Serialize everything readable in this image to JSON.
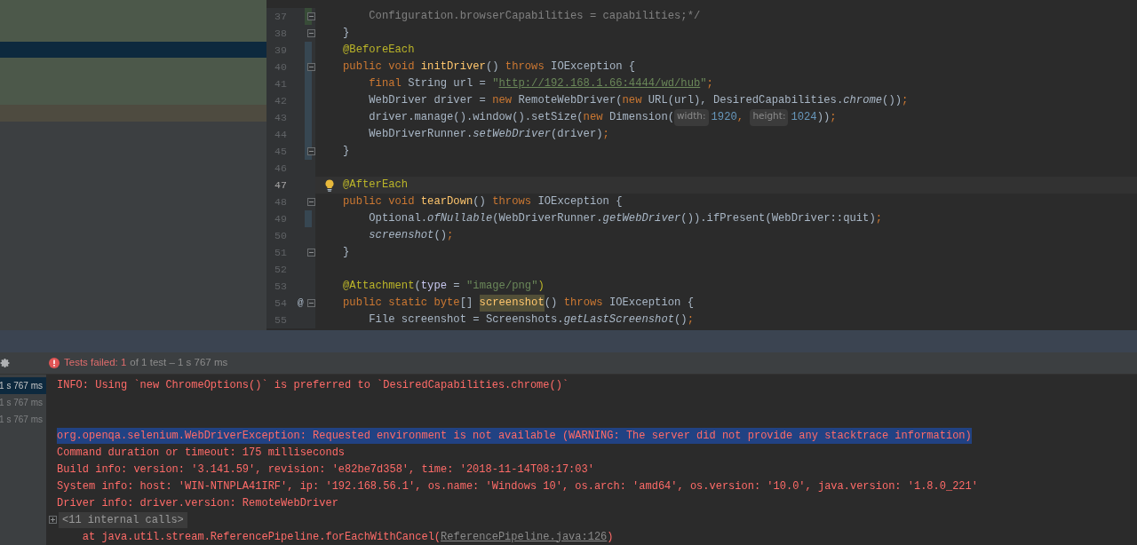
{
  "side_panel": {
    "bands": [
      {
        "color": "#4c584a"
      },
      {
        "color": "#0d293e"
      },
      {
        "color": "#4c584a"
      },
      {
        "color": "#4e4b40"
      }
    ]
  },
  "editor": {
    "lines": [
      {
        "number": "37",
        "fold": true,
        "changed": true,
        "color": "#384c38",
        "current": false,
        "tokens": [
          {
            "kind": "comment",
            "text": "    Configuration.browserCapabilities = capabilities;*/"
          }
        ]
      },
      {
        "number": "38",
        "fold": true,
        "changed": false,
        "current": false,
        "tokens": [
          {
            "kind": "plain",
            "text": "}"
          }
        ]
      },
      {
        "number": "39",
        "fold": false,
        "changed": true,
        "color": "#374752",
        "current": false,
        "tokens": [
          {
            "kind": "ann",
            "text": "@BeforeEach"
          }
        ]
      },
      {
        "number": "40",
        "fold": true,
        "changed": true,
        "color": "#374752",
        "current": false,
        "tokens": [
          {
            "kind": "kw",
            "text": "public void "
          },
          {
            "kind": "fn",
            "text": "initDriver"
          },
          {
            "kind": "plain",
            "text": "() "
          },
          {
            "kind": "kw",
            "text": "throws "
          },
          {
            "kind": "plain",
            "text": "IOException {"
          }
        ]
      },
      {
        "number": "41",
        "fold": false,
        "changed": true,
        "color": "#374752",
        "current": false,
        "tokens": [
          {
            "kind": "kw",
            "text": "    final "
          },
          {
            "kind": "plain",
            "text": "String url = "
          },
          {
            "kind": "str",
            "text": "\""
          },
          {
            "kind": "link",
            "text": "http://192.168.1.66:4444/wd/hub"
          },
          {
            "kind": "str",
            "text": "\""
          },
          {
            "kind": "kw",
            "text": ";"
          }
        ]
      },
      {
        "number": "42",
        "fold": false,
        "changed": true,
        "color": "#374752",
        "current": false,
        "tokens": [
          {
            "kind": "plain",
            "text": "    WebDriver driver = "
          },
          {
            "kind": "kw",
            "text": "new "
          },
          {
            "kind": "plain",
            "text": "RemoteWebDriver("
          },
          {
            "kind": "kw",
            "text": "new "
          },
          {
            "kind": "plain",
            "text": "URL(url), DesiredCapabilities."
          },
          {
            "kind": "italic",
            "text": "chrome"
          },
          {
            "kind": "plain",
            "text": "())"
          },
          {
            "kind": "kw",
            "text": ";"
          }
        ]
      },
      {
        "number": "43",
        "fold": false,
        "changed": true,
        "color": "#374752",
        "current": false,
        "tokens": [
          {
            "kind": "plain",
            "text": "    driver.manage().window().setSize("
          },
          {
            "kind": "kw",
            "text": "new "
          },
          {
            "kind": "plain",
            "text": "Dimension("
          },
          {
            "kind": "hint",
            "text": "width:"
          },
          {
            "kind": "num",
            "text": "1920"
          },
          {
            "kind": "kw",
            "text": ", "
          },
          {
            "kind": "hint",
            "text": "height:"
          },
          {
            "kind": "num",
            "text": "1024"
          },
          {
            "kind": "plain",
            "text": "))"
          },
          {
            "kind": "kw",
            "text": ";"
          }
        ]
      },
      {
        "number": "44",
        "fold": false,
        "changed": true,
        "color": "#374752",
        "current": false,
        "tokens": [
          {
            "kind": "plain",
            "text": "    WebDriverRunner."
          },
          {
            "kind": "italic",
            "text": "setWebDriver"
          },
          {
            "kind": "plain",
            "text": "(driver)"
          },
          {
            "kind": "kw",
            "text": ";"
          }
        ]
      },
      {
        "number": "45",
        "fold": true,
        "changed": true,
        "color": "#374752",
        "current": false,
        "tokens": [
          {
            "kind": "plain",
            "text": "}"
          }
        ]
      },
      {
        "number": "46",
        "fold": false,
        "changed": false,
        "current": false
      },
      {
        "number": "47",
        "fold": false,
        "changed": false,
        "current": true,
        "bulb": true,
        "tokens": [
          {
            "kind": "ann",
            "text": "@AfterEach"
          }
        ]
      },
      {
        "number": "48",
        "fold": true,
        "changed": false,
        "current": false,
        "tokens": [
          {
            "kind": "kw",
            "text": "public void "
          },
          {
            "kind": "fn",
            "text": "tearDown"
          },
          {
            "kind": "plain",
            "text": "() "
          },
          {
            "kind": "kw",
            "text": "throws "
          },
          {
            "kind": "plain",
            "text": "IOException {"
          }
        ]
      },
      {
        "number": "49",
        "fold": false,
        "changed": true,
        "color": "#374752",
        "current": false,
        "tokens": [
          {
            "kind": "plain",
            "text": "    Optional."
          },
          {
            "kind": "italic",
            "text": "ofNullable"
          },
          {
            "kind": "plain",
            "text": "(WebDriverRunner."
          },
          {
            "kind": "italic",
            "text": "getWebDriver"
          },
          {
            "kind": "plain",
            "text": "()).ifPresent(WebDriver::quit)"
          },
          {
            "kind": "kw",
            "text": ";"
          }
        ]
      },
      {
        "number": "50",
        "fold": false,
        "changed": false,
        "current": false,
        "tokens": [
          {
            "kind": "italic",
            "text": "    screenshot"
          },
          {
            "kind": "plain",
            "text": "()"
          },
          {
            "kind": "kw",
            "text": ";"
          }
        ]
      },
      {
        "number": "51",
        "fold": true,
        "changed": false,
        "current": false,
        "tokens": [
          {
            "kind": "plain",
            "text": "}"
          }
        ]
      },
      {
        "number": "52",
        "fold": false,
        "changed": false,
        "current": false
      },
      {
        "number": "53",
        "fold": false,
        "changed": false,
        "current": false,
        "tokens": [
          {
            "kind": "ann",
            "text": "@Attachment"
          },
          {
            "kind": "plain",
            "text": "("
          },
          {
            "kind": "param",
            "text": "type"
          },
          {
            "kind": "plain",
            "text": " = "
          },
          {
            "kind": "str",
            "text": "\"image/png\""
          },
          {
            "kind": "ann",
            "text": ")"
          }
        ]
      },
      {
        "number": "54",
        "marker": "@",
        "fold": true,
        "changed": false,
        "current": false,
        "tokens": [
          {
            "kind": "kw",
            "text": "public static byte"
          },
          {
            "kind": "plain",
            "text": "[] "
          },
          {
            "kind": "match",
            "text": "screenshot"
          },
          {
            "kind": "plain",
            "text": "() "
          },
          {
            "kind": "kw",
            "text": "throws "
          },
          {
            "kind": "plain",
            "text": "IOException {"
          }
        ]
      },
      {
        "number": "55",
        "fold": false,
        "changed": false,
        "current": false,
        "tokens": [
          {
            "kind": "plain",
            "text": "    File screenshot = Screenshots."
          },
          {
            "kind": "italic",
            "text": "getLastScreenshot"
          },
          {
            "kind": "plain",
            "text": "()"
          },
          {
            "kind": "kw",
            "text": ";"
          }
        ]
      }
    ]
  },
  "test_panel": {
    "failed_label": "Tests failed: 1",
    "summary": "of 1 test – 1 s 767 ms",
    "durations": [
      {
        "text": "1 s 767 ms",
        "selected": true
      },
      {
        "text": "1 s 767 ms",
        "selected": false
      },
      {
        "text": "1 s 767 ms",
        "selected": false
      }
    ],
    "console": [
      {
        "kind": "text",
        "text": "INFO: Using `new ChromeOptions()` is preferred to `DesiredCapabilities.chrome()`",
        "selected": false
      },
      {
        "kind": "blank"
      },
      {
        "kind": "blank"
      },
      {
        "kind": "text",
        "text": "org.openqa.selenium.WebDriverException: Requested environment is not available (WARNING: The server did not provide any stacktrace information)",
        "selected": true
      },
      {
        "kind": "text",
        "text": "Command duration or timeout: 175 milliseconds",
        "selected": false
      },
      {
        "kind": "text",
        "text": "Build info: version: '3.141.59', revision: 'e82be7d358', time: '2018-11-14T08:17:03'",
        "selected": false
      },
      {
        "kind": "text",
        "text": "System info: host: 'WIN-NTNPLA41IRF', ip: '192.168.56.1', os.name: 'Windows 10', os.arch: 'amd64', os.version: '10.0', java.version: '1.8.0_221'",
        "selected": false
      },
      {
        "kind": "text",
        "text": "Driver info: driver.version: RemoteWebDriver",
        "selected": false
      },
      {
        "kind": "folded",
        "text": "<11 internal calls>"
      },
      {
        "kind": "trace",
        "text": "    at java.util.stream.ReferencePipeline.forEachWithCancel(",
        "link": "ReferencePipeline.java:126",
        "suffix": ")"
      }
    ]
  }
}
